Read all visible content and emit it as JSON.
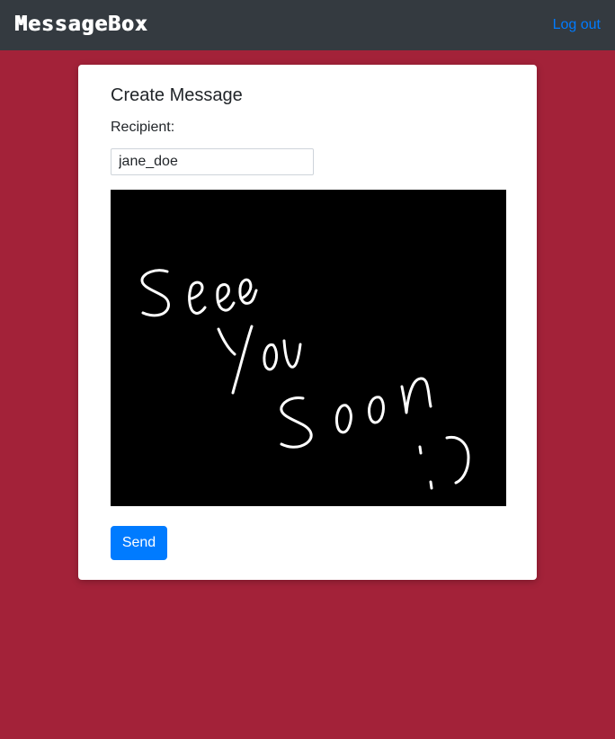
{
  "navbar": {
    "brand": "MessageBox",
    "logout_label": "Log out"
  },
  "card": {
    "title": "Create Message",
    "recipient_label": "Recipient:",
    "recipient_value": "jane_doe",
    "send_label": "Send"
  },
  "drawing": {
    "handwritten_text": "See You Soon :)",
    "background_color": "#000000",
    "stroke_color": "#ffffff"
  },
  "colors": {
    "page_background": "#a32239",
    "navbar_background": "#343a40",
    "link": "#007bff",
    "primary_button": "#007bff"
  }
}
